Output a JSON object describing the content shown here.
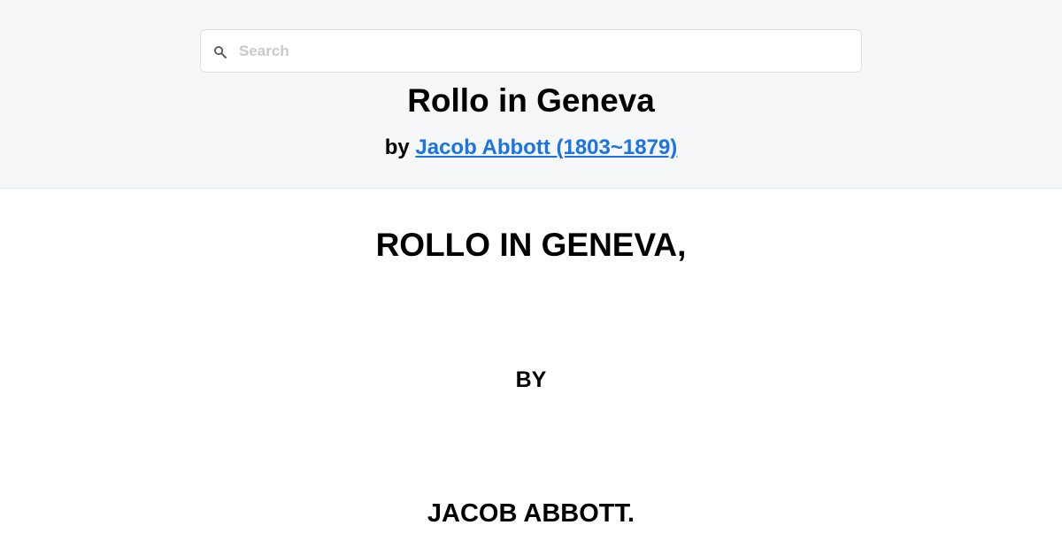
{
  "search": {
    "placeholder": "Search",
    "value": ""
  },
  "header": {
    "book_title": "Rollo in Geneva",
    "by_prefix": "by",
    "author_link": "Jacob Abbott (1803~1879)"
  },
  "content": {
    "title": "ROLLO IN GENEVA,",
    "by": "BY",
    "author": "JACOB ABBOTT."
  },
  "colors": {
    "header_bg": "#f6f7f9",
    "link": "#1a73e8"
  },
  "icons": {
    "search": "search-icon"
  }
}
